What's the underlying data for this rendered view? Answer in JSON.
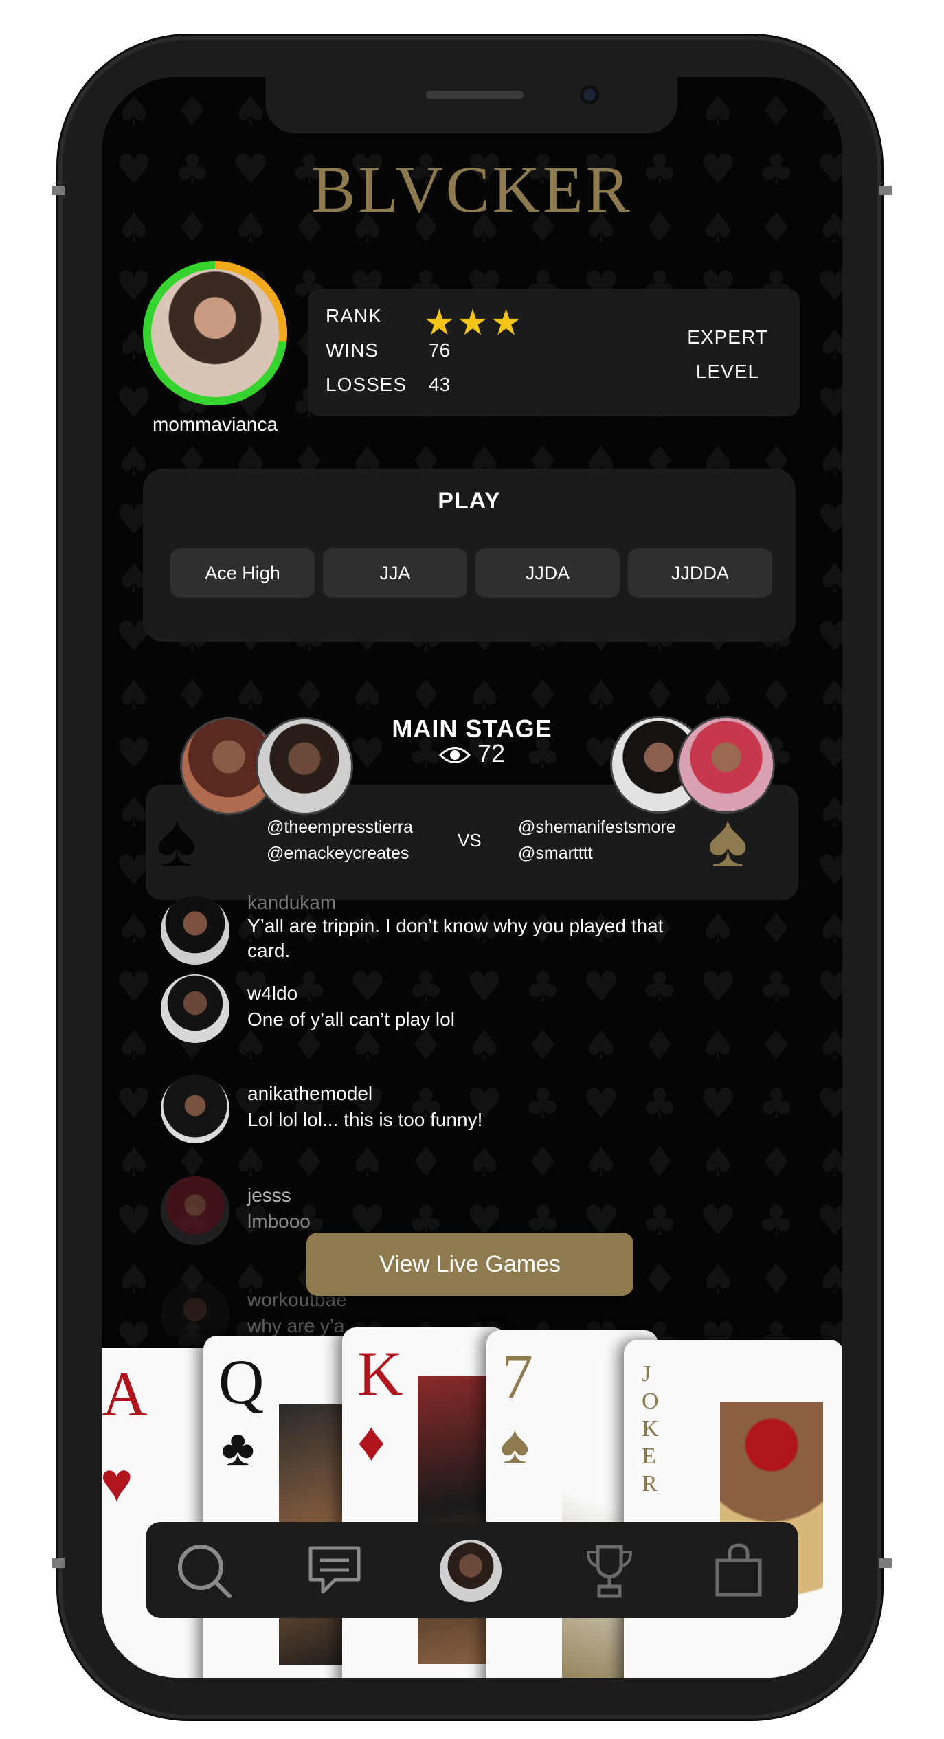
{
  "app": {
    "logo": "BLVCKER"
  },
  "profile": {
    "username": "mommavianca",
    "rank_stars": 3
  },
  "stats": {
    "rank_label": "RANK",
    "wins_label": "WINS",
    "wins_value": "76",
    "losses_label": "LOSSES",
    "losses_value": "43",
    "level_line1": "EXPERT",
    "level_line2": "LEVEL"
  },
  "play": {
    "title": "PLAY",
    "modes": [
      "Ace High",
      "JJA",
      "JJDA",
      "JJDDA"
    ]
  },
  "main_stage": {
    "title": "MAIN STAGE",
    "viewers": "72",
    "team_left": [
      "@theempresstierra",
      "@emackeycreates"
    ],
    "vs": "VS",
    "team_right": [
      "@shemanifestsmore",
      "@smartttt"
    ]
  },
  "chat": [
    {
      "name": "kandukam",
      "message": "Y’all are trippin. I don’t know why you played that card."
    },
    {
      "name": "w4ldo",
      "message": "One of y’all can’t play lol"
    },
    {
      "name": "anikathemodel",
      "message": "Lol lol lol... this is too funny!"
    },
    {
      "name": "jesss",
      "message": "lmbooo"
    },
    {
      "name": "workoutbae",
      "message": "why are y’a"
    }
  ],
  "cta": {
    "label": "View Live Games"
  },
  "cards": [
    "A",
    "Q",
    "K",
    "7",
    "JOKER"
  ],
  "nav": {
    "items": [
      "search-icon",
      "chat-icon",
      "profile-avatar",
      "trophy-icon",
      "shop-bag-icon"
    ]
  },
  "colors": {
    "gold": "#8d7b4f",
    "ring_green": "#36d42e",
    "ring_orange": "#f2a91b",
    "star": "#f5c518"
  }
}
